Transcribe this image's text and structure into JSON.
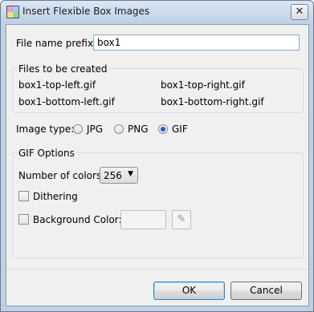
{
  "window": {
    "title": "Insert Flexible Box Images",
    "close_label": "✕"
  },
  "prefix": {
    "label": "File name prefix:",
    "value": "box1"
  },
  "files": {
    "legend": "Files to be created",
    "items": [
      "box1-top-left.gif",
      "box1-top-right.gif",
      "box1-bottom-left.gif",
      "box1-bottom-right.gif"
    ]
  },
  "image_type": {
    "label": "Image type:",
    "options": [
      "JPG",
      "PNG",
      "GIF"
    ],
    "selected": "GIF"
  },
  "gif_options": {
    "legend": "GIF Options",
    "colors_label": "Number of colors:",
    "colors_value": "256",
    "dithering_label": "Dithering",
    "dithering_checked": false,
    "bgcolor_label": "Background Color:",
    "bgcolor_checked": false
  },
  "buttons": {
    "ok": "OK",
    "cancel": "Cancel"
  }
}
